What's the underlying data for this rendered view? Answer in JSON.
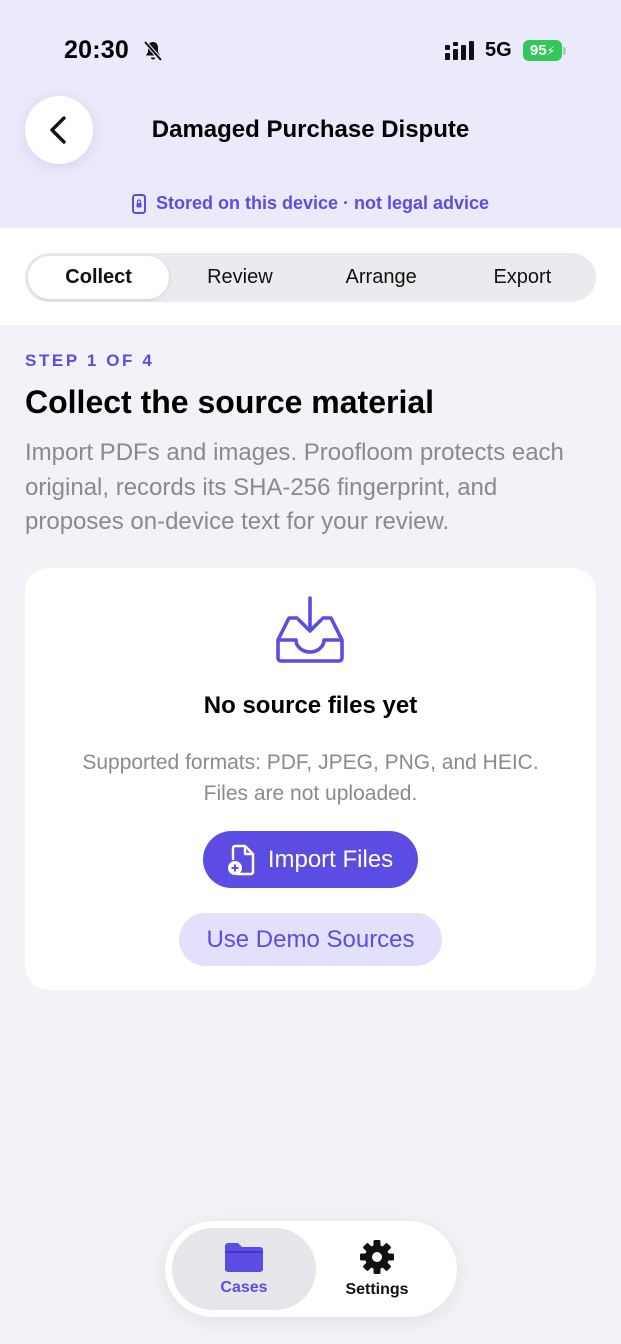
{
  "status_bar": {
    "time": "20:30",
    "network": "5G",
    "battery": "95"
  },
  "header": {
    "title": "Damaged Purchase Dispute",
    "notice": "Stored on this device · not legal advice"
  },
  "tabs": [
    {
      "label": "Collect",
      "active": true
    },
    {
      "label": "Review",
      "active": false
    },
    {
      "label": "Arrange",
      "active": false
    },
    {
      "label": "Export",
      "active": false
    }
  ],
  "step": {
    "label": "STEP 1 OF 4",
    "heading": "Collect the source material",
    "description": "Import PDFs and images. Proofloom protects each original, records its SHA-256 fingerprint, and proposes on-device text for your review."
  },
  "empty_state": {
    "title": "No source files yet",
    "description_line1": "Supported formats: PDF, JPEG, PNG, and HEIC.",
    "description_line2": "Files are not uploaded.",
    "import_label": "Import Files",
    "demo_label": "Use Demo Sources"
  },
  "tabbar": {
    "items": [
      {
        "label": "Cases",
        "icon": "folder-icon",
        "active": true
      },
      {
        "label": "Settings",
        "icon": "gear-icon",
        "active": false
      }
    ]
  },
  "colors": {
    "accent": "#5b4de3",
    "header_bg": "#ebeafa",
    "battery": "#34c759",
    "background": "#f2f2f7"
  }
}
